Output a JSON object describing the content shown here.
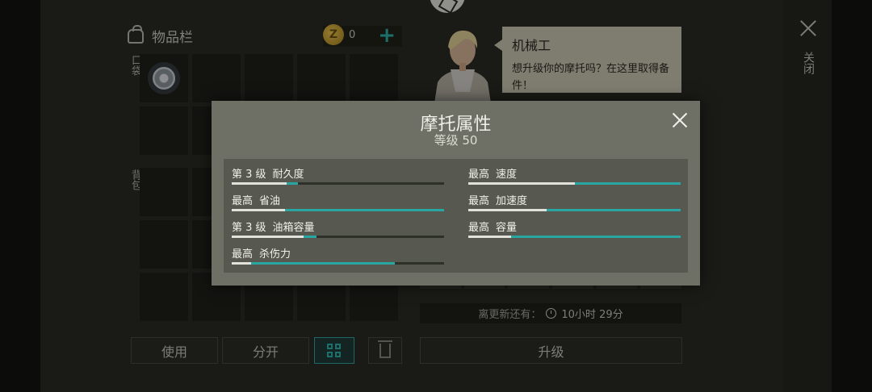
{
  "inventory": {
    "title": "物品栏",
    "coins": "0",
    "coin_symbol": "Z",
    "pocket_label": "口袋",
    "backpack_label": "背包",
    "items": [
      {
        "icon": "tire-icon"
      }
    ]
  },
  "actions": {
    "use": "使用",
    "split": "分开",
    "upgrade": "升级"
  },
  "mechanic": {
    "name": "机械工",
    "message": "想升级你的摩托吗？在这里取得备件！"
  },
  "close_label": "关闭",
  "timer": {
    "label": "离更新还有：",
    "value": "10小时 29分"
  },
  "modal": {
    "title": "摩托属性",
    "subtitle": "等级 50",
    "stats": [
      {
        "level": "第 3 级",
        "name": "耐久度",
        "white": 0.26,
        "teal": 0.05
      },
      {
        "level": "最高",
        "name": "速度",
        "white": 0.5,
        "teal": 0.5
      },
      {
        "level": "最高",
        "name": "省油",
        "white": 0.25,
        "teal": 0.75
      },
      {
        "level": "最高",
        "name": "加速度",
        "white": 0.37,
        "teal": 0.63
      },
      {
        "level": "第 3 级",
        "name": "油箱容量",
        "white": 0.34,
        "teal": 0.06
      },
      {
        "level": "最高",
        "name": "容量",
        "white": 0.2,
        "teal": 0.8
      },
      {
        "level": "最高",
        "name": "杀伤力",
        "white": 0.09,
        "teal": 0.68
      }
    ]
  },
  "colors": {
    "teal": "#2aa6a2",
    "white": "#e2e2dc",
    "empty": "#2e302a"
  }
}
